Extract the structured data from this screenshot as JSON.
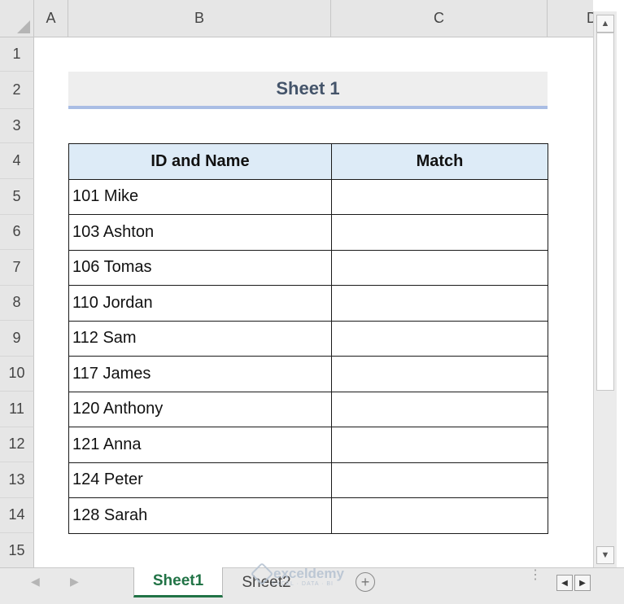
{
  "columns": [
    "A",
    "B",
    "C",
    "D"
  ],
  "rows": [
    "1",
    "2",
    "3",
    "4",
    "5",
    "6",
    "7",
    "8",
    "9",
    "10",
    "11",
    "12",
    "13",
    "14",
    "15"
  ],
  "title": "Sheet 1",
  "table": {
    "headers": [
      "ID and Name",
      "Match"
    ],
    "rows": [
      [
        "101 Mike",
        ""
      ],
      [
        "103 Ashton",
        ""
      ],
      [
        "106 Tomas",
        ""
      ],
      [
        "110 Jordan",
        ""
      ],
      [
        "112 Sam",
        ""
      ],
      [
        "117 James",
        ""
      ],
      [
        "120 Anthony",
        ""
      ],
      [
        "121 Anna",
        ""
      ],
      [
        "124 Peter",
        ""
      ],
      [
        "128 Sarah",
        ""
      ]
    ]
  },
  "tabs": [
    {
      "label": "Sheet1",
      "active": true
    },
    {
      "label": "Sheet2",
      "active": false
    }
  ],
  "watermark": {
    "name": "exceldemy",
    "tagline": "EXCEL · DATA · BI"
  },
  "icons": {
    "scroll_up": "▲",
    "scroll_down": "▼",
    "tab_prev": "◀",
    "tab_next": "▶",
    "add_sheet": "+",
    "more": "⋮",
    "hscroll_left": "◀",
    "hscroll_right": "▶"
  },
  "colors": {
    "header_fill": "#ddebf7",
    "title_underline": "#a9bde4",
    "active_tab": "#217346"
  }
}
